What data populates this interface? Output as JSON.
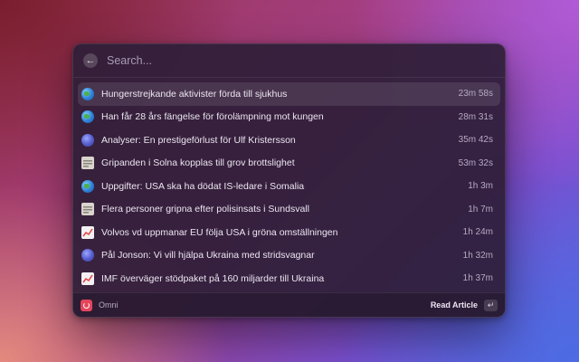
{
  "search": {
    "placeholder": "Search..."
  },
  "items": [
    {
      "icon": "globe-icon",
      "title": "Hungerstrejkande aktivister förda till sjukhus",
      "time": "23m 58s",
      "selected": true
    },
    {
      "icon": "globe-icon",
      "title": "Han får 28 års fängelse för förolämpning mot kungen",
      "time": "28m 31s"
    },
    {
      "icon": "orb-icon",
      "title": "Analyser: En prestigeförlust för Ulf Kristersson",
      "time": "35m 42s"
    },
    {
      "icon": "newspaper-icon",
      "title": "Gripanden i Solna kopplas till grov brottslighet",
      "time": "53m 32s"
    },
    {
      "icon": "globe-icon",
      "title": "Uppgifter: USA ska ha dödat IS-ledare i Somalia",
      "time": "1h 3m"
    },
    {
      "icon": "newspaper-icon",
      "title": "Flera personer gripna efter polisinsats i Sundsvall",
      "time": "1h 7m"
    },
    {
      "icon": "chart-up-icon",
      "title": "Volvos vd uppmanar EU följa USA i gröna omställningen",
      "time": "1h 24m"
    },
    {
      "icon": "orb-icon",
      "title": "Pål Jonson: Vi vill hjälpa Ukraina med stridsvagnar",
      "time": "1h 32m"
    },
    {
      "icon": "chart-up-icon",
      "title": "IMF överväger stödpaket på 160 miljarder till Ukraina",
      "time": "1h 37m"
    }
  ],
  "footer": {
    "app_name": "Omni",
    "action_label": "Read Article",
    "enter_key": "↵"
  }
}
